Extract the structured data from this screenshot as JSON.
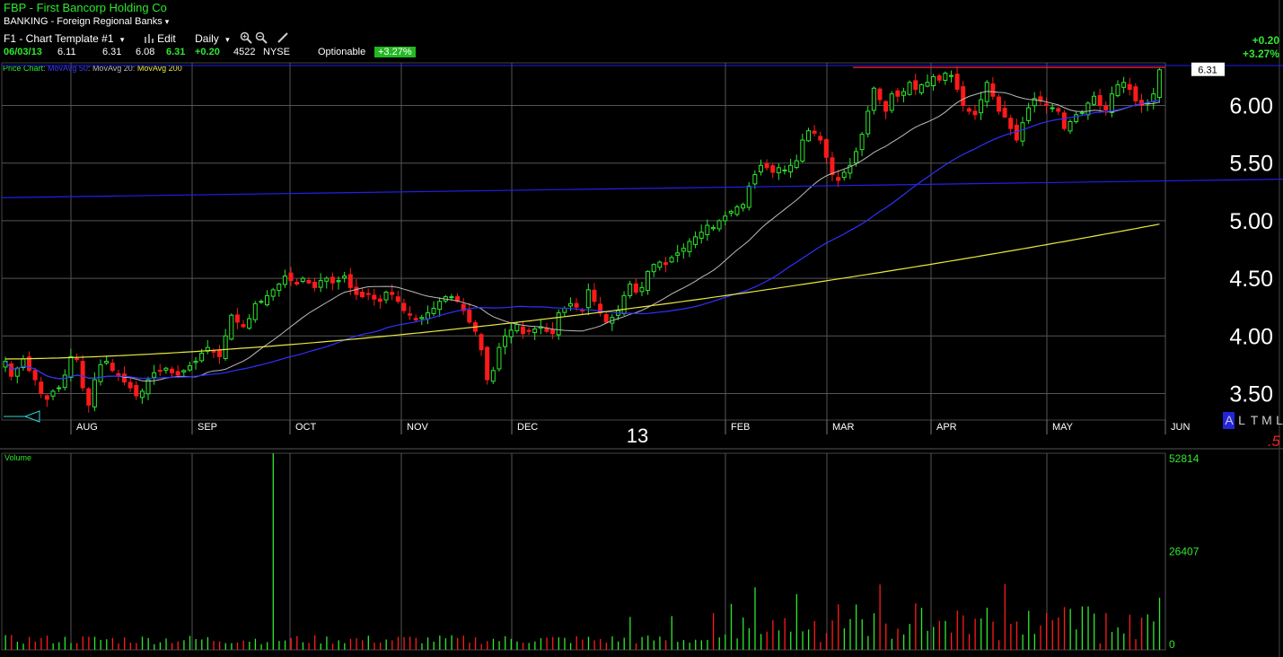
{
  "header": {
    "symbol": "FBP",
    "company": "First Bancorp Holding Co",
    "industry": "BANKING - Foreign Regional Banks",
    "industry_caret": "▾",
    "toolbar": {
      "template": "F1 - Chart Template #1",
      "template_caret": "▾",
      "edit": "Edit",
      "period": "Daily",
      "period_caret": "▾",
      "zoom_in_icon": "zoom-in-icon",
      "zoom_out_icon": "zoom-out-icon",
      "draw_icon": "pencil-icon"
    },
    "quote": {
      "date": "06/03/13",
      "open": "6.11",
      "high": "6.31",
      "low": "6.08",
      "close": "6.31",
      "change": "+0.20",
      "volume": "4522",
      "exchange": "NYSE",
      "optionable": "Optionable",
      "pct_change": "+3.27%"
    },
    "right_change": "+0.20",
    "right_pct": "+3.27%"
  },
  "legend": {
    "price_chart": "Price Chart",
    "ma50": "MovAvg 50",
    "ma20": "MovAvg 20",
    "ma200": "MovAvg 200",
    "volume_label": "Volume"
  },
  "chart_data": {
    "type": "candlestick",
    "price_axis_ticks": [
      "6.00",
      "5.50",
      "5.00",
      "4.50",
      "4.00",
      "3.50"
    ],
    "ylim": [
      3.27,
      6.37
    ],
    "last_price_tag": "6.31",
    "x_month_labels": [
      "AUG",
      "SEP",
      "OCT",
      "NOV",
      "DEC",
      "FEB",
      "MAR",
      "APR",
      "MAY",
      "JUN"
    ],
    "year_label": "13",
    "axis_flags": [
      "A",
      "L",
      "T",
      "M",
      "L"
    ],
    "axis_extra": ".5",
    "volume_axis_ticks": [
      "52814",
      "26407",
      "0"
    ],
    "volume_ylim": [
      0,
      52814
    ],
    "resistance_level": 6.33,
    "horizontal_trend_start": 5.2,
    "horizontal_trend_end": 5.36,
    "closes": [
      3.78,
      3.65,
      3.72,
      3.8,
      3.7,
      3.62,
      3.5,
      3.45,
      3.52,
      3.55,
      3.66,
      3.82,
      3.8,
      3.55,
      3.4,
      3.62,
      3.75,
      3.78,
      3.7,
      3.66,
      3.6,
      3.55,
      3.48,
      3.52,
      3.62,
      3.68,
      3.7,
      3.72,
      3.68,
      3.66,
      3.7,
      3.74,
      3.78,
      3.85,
      3.9,
      3.86,
      3.82,
      4.0,
      4.18,
      4.12,
      4.08,
      4.15,
      4.28,
      4.3,
      4.35,
      4.4,
      4.45,
      4.52,
      4.48,
      4.45,
      4.5,
      4.46,
      4.42,
      4.48,
      4.5,
      4.46,
      4.48,
      4.52,
      4.42,
      4.36,
      4.34,
      4.36,
      4.32,
      4.3,
      4.38,
      4.36,
      4.3,
      4.22,
      4.18,
      4.14,
      4.16,
      4.2,
      4.24,
      4.3,
      4.34,
      4.34,
      4.3,
      4.22,
      4.12,
      4.04,
      3.88,
      3.62,
      3.7,
      3.9,
      4.0,
      4.05,
      4.1,
      4.02,
      4.04,
      4.06,
      4.08,
      4.04,
      4.02,
      4.2,
      4.24,
      4.28,
      4.25,
      4.22,
      4.4,
      4.3,
      4.2,
      4.12,
      4.16,
      4.22,
      4.35,
      4.45,
      4.38,
      4.42,
      4.56,
      4.62,
      4.64,
      4.62,
      4.68,
      4.72,
      4.76,
      4.82,
      4.86,
      4.9,
      4.96,
      4.94,
      5.0,
      5.04,
      5.08,
      5.12,
      5.14,
      5.3,
      5.4,
      5.48,
      5.46,
      5.42,
      5.46,
      5.44,
      5.48,
      5.52,
      5.7,
      5.78,
      5.76,
      5.7,
      5.55,
      5.4,
      5.35,
      5.42,
      5.48,
      5.6,
      5.75,
      5.95,
      6.15,
      6.05,
      5.95,
      6.1,
      6.08,
      6.12,
      6.2,
      6.14,
      6.18,
      6.2,
      6.25,
      6.22,
      6.28,
      6.26,
      6.14,
      6.0,
      5.95,
      5.92,
      6.05,
      6.2,
      6.08,
      5.95,
      5.9,
      5.8,
      5.7,
      5.85,
      5.98,
      6.06,
      6.04,
      6.0,
      5.98,
      5.95,
      5.8,
      5.86,
      5.92,
      5.94,
      6.02,
      6.08,
      6.0,
      5.96,
      6.1,
      6.18,
      6.2,
      6.14,
      6.04,
      6.0,
      6.02,
      6.1,
      6.31
    ]
  }
}
